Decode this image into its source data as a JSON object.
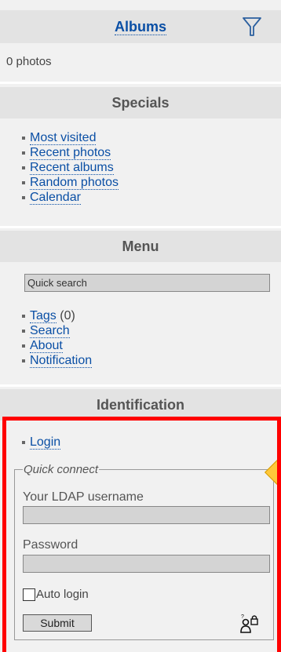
{
  "albums": {
    "title": "Albums",
    "photo_count": "0 photos"
  },
  "specials": {
    "title": "Specials",
    "items": [
      {
        "label": "Most visited"
      },
      {
        "label": "Recent photos"
      },
      {
        "label": "Recent albums"
      },
      {
        "label": "Random photos"
      },
      {
        "label": "Calendar"
      }
    ]
  },
  "menu": {
    "title": "Menu",
    "search_value": "Quick search",
    "items": [
      {
        "label": "Tags",
        "count": "(0)"
      },
      {
        "label": "Search"
      },
      {
        "label": "About"
      },
      {
        "label": "Notification"
      }
    ]
  },
  "identification": {
    "title": "Identification",
    "login_label": "Login",
    "quick_connect": {
      "legend": "Quick connect",
      "username_label": "Your LDAP username",
      "password_label": "Password",
      "auto_login_label": "Auto login",
      "submit_label": "Submit"
    }
  },
  "colors": {
    "link": "#0a4fa5",
    "highlight_border": "#ff0000",
    "section_bg": "#e3e3e3"
  }
}
